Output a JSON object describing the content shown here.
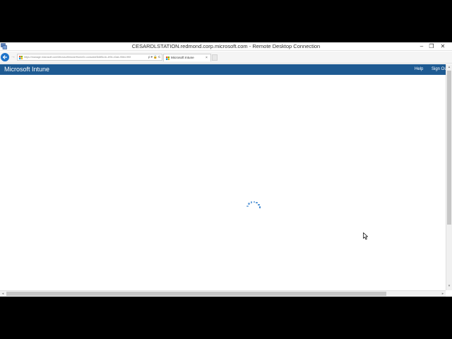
{
  "rdp_window": {
    "title": "CESARDLSTATION.redmond.corp.microsoft.com - Remote Desktop Connection",
    "minimize_glyph": "–",
    "maximize_glyph": "❐",
    "close_glyph": "✕",
    "icons": {
      "app": "remote-desktop-icon"
    }
  },
  "browser": {
    "address_url": "https://manage.microsoft.com/MicrosoftIntune/Home/Ix.console#3b8f5c1b-4f94-43ab-9564-9f0f",
    "address_icons_text": "ρ ▾ 🔒 C",
    "forward_glyph": "→",
    "tab": {
      "label": "Microsoft Intune",
      "close_glyph": "×"
    },
    "icons": {
      "back": "back-arrow-icon",
      "favicon": "microsoft-logo-icon"
    }
  },
  "intune": {
    "brand": "Microsoft Intune",
    "nav": {
      "help": "Help",
      "sign_out": "Sign Out"
    },
    "colors": {
      "header": "#1e5a92",
      "spinner": "#1e73c9"
    }
  },
  "loading": {
    "state": "loading",
    "icon": "loading-spinner-icon"
  },
  "scrollbars": {
    "up_glyph": "▴",
    "down_glyph": "▾",
    "left_glyph": "◂",
    "right_glyph": "▸"
  }
}
